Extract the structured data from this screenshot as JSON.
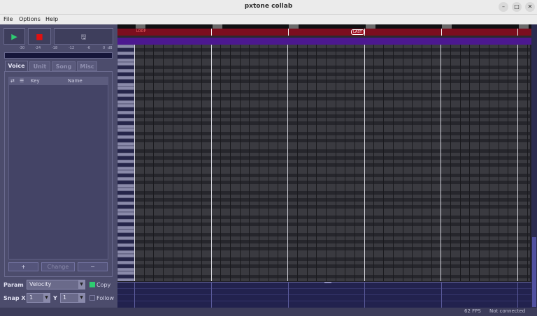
{
  "window": {
    "title": "pxtone collab"
  },
  "menu": [
    "File",
    "Options",
    "Help"
  ],
  "transport": {
    "play_icon": "play-icon",
    "stop_icon": "stop-icon",
    "save_icon": "save-icon"
  },
  "meter": {
    "scale": [
      "-30",
      "-24",
      "-18",
      "-12",
      "-6",
      "0",
      "dB"
    ]
  },
  "tabs": [
    {
      "label": "Voice",
      "active": true
    },
    {
      "label": "Unit",
      "active": false
    },
    {
      "label": "Song",
      "active": false
    },
    {
      "label": "Misc",
      "active": false
    }
  ],
  "voice_list": {
    "columns": [
      "Key",
      "Name"
    ]
  },
  "voice_buttons": {
    "add": "+",
    "change": "Change",
    "remove": "−"
  },
  "param": {
    "label": "Param",
    "value": "Velocity",
    "copy_label": "Copy",
    "copy_checked": true
  },
  "snap": {
    "label": "Snap X",
    "x_value": "1",
    "y_label": "Y",
    "y_value": "1",
    "follow_label": "Follow",
    "follow_checked": false
  },
  "editor": {
    "marker_left": "LOOP",
    "marker_right": "LAST"
  },
  "status": {
    "fps": "62 FPS",
    "connection": "Not connected"
  },
  "colors": {
    "red_bar": "#7c0e1e",
    "purple_bar": "#4c1890",
    "accent_green": "#2ecc71",
    "stop_red": "#e01010"
  }
}
